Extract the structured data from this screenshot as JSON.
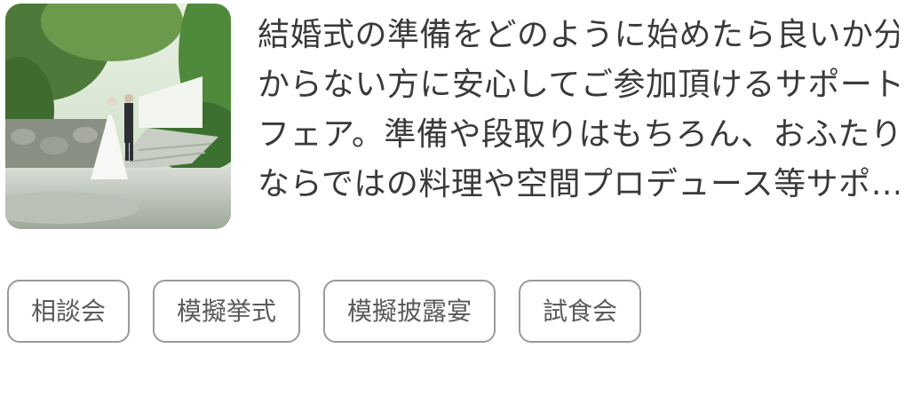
{
  "fair": {
    "description_lines": [
      "結婚式の準備をどのように始めたら良いか分",
      "からない方に安心してご参加頂けるサポート",
      "フェア。準備や段取りはもちろん、おふたり",
      "ならではの料理や空間プロデュース等サポ…"
    ],
    "tags": [
      "相談会",
      "模擬挙式",
      "模擬披露宴",
      "試食会"
    ]
  },
  "colors": {
    "text": "#3a3a3a",
    "tag_border": "#9a9a9a",
    "tag_text": "#5a5a5a"
  }
}
